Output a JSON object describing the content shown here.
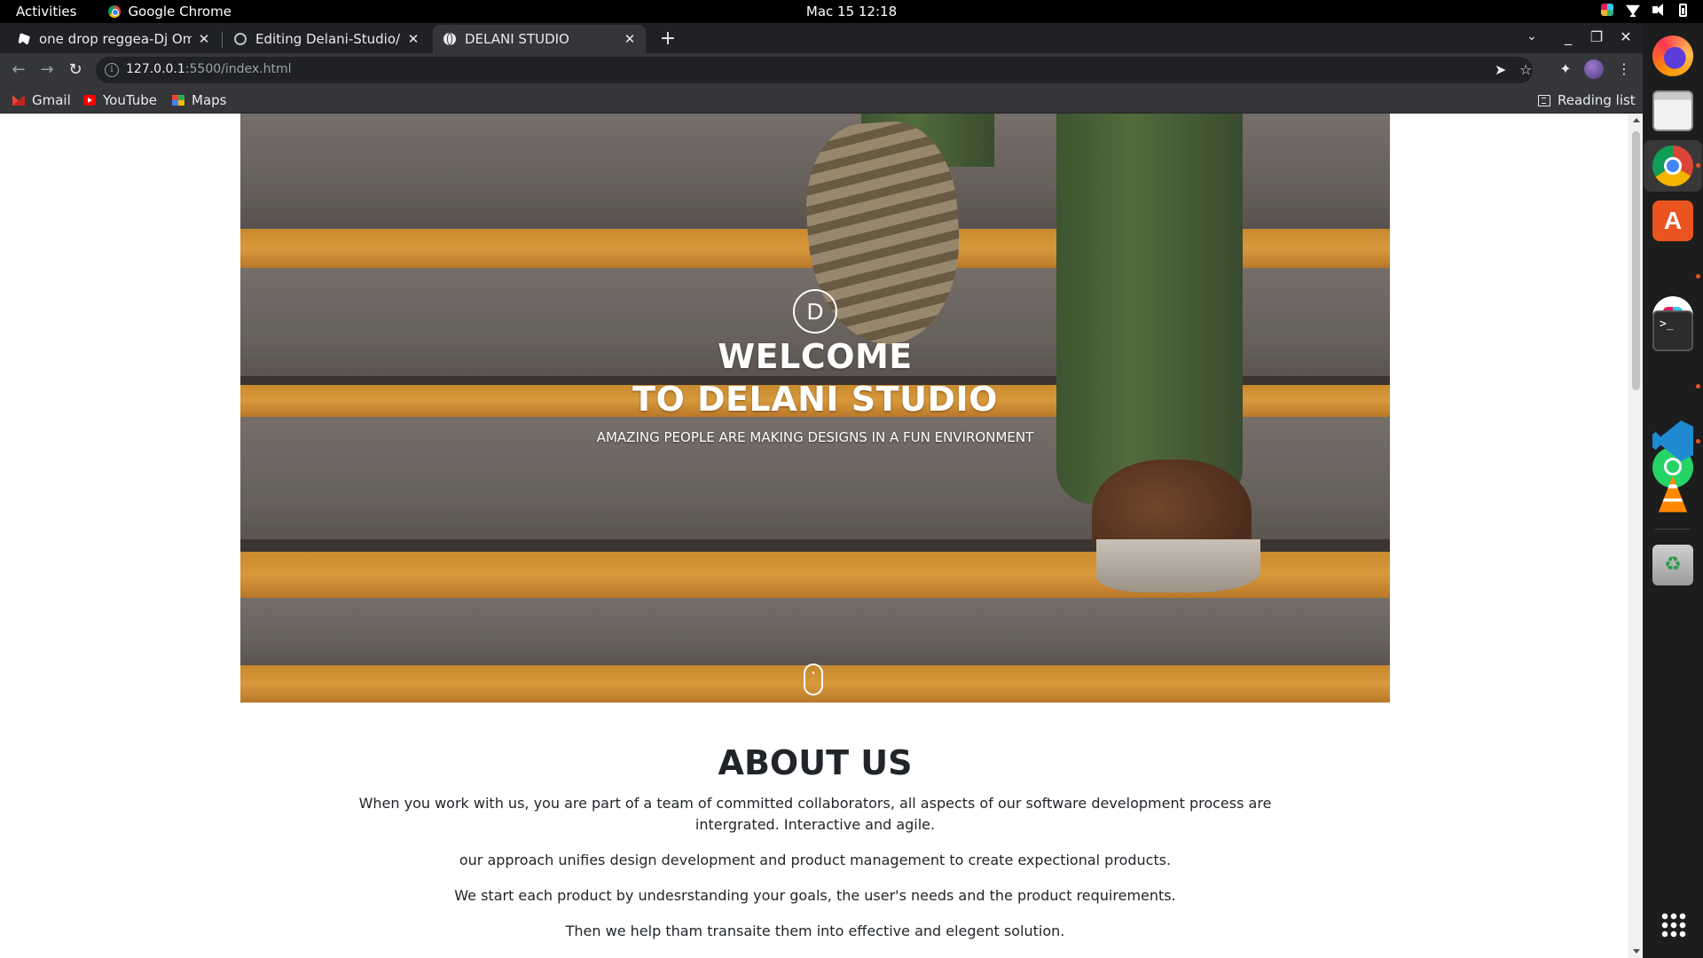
{
  "system_bar": {
    "activities": "Activities",
    "app_name": "Google Chrome",
    "datetime": "Mac 15  12:18"
  },
  "browser": {
    "tabs": [
      {
        "title": "one drop reggea-Dj Omsh",
        "icon": "music-icon",
        "active": false
      },
      {
        "title": "Editing Delani-Studio/RE/",
        "icon": "github-icon",
        "active": false
      },
      {
        "title": "DELANI STUDIO",
        "icon": "globe-icon",
        "active": true
      }
    ],
    "address": {
      "host": "127.0.0.1",
      "rest": ":5500/index.html"
    },
    "bookmarks": [
      {
        "label": "Gmail",
        "icon": "gmail-icon"
      },
      {
        "label": "YouTube",
        "icon": "youtube-icon"
      },
      {
        "label": "Maps",
        "icon": "maps-icon"
      }
    ],
    "reading_list": "Reading list"
  },
  "page": {
    "hero": {
      "logo_letter": "D",
      "title_line1": "WELCOME",
      "title_line2": "TO DELANI STUDIO",
      "subtitle": "AMAZING PEOPLE ARE MAKING DESIGNS IN A FUN ENVIRONMENT",
      "scroll_icon": "mouse-icon"
    },
    "about": {
      "heading": "ABOUT US",
      "paragraphs": [
        "When you work with us, you are part of a team of committed collaborators, all aspects of our software development process are intergrated. Interactive and agile.",
        "our approach unifies design development and product management to create expectional products.",
        "We start each product by undesrstanding your goals, the user's needs and the product requirements.",
        "Then we help tham transaite them into effective and elegent solution."
      ]
    }
  },
  "dock": {
    "apps": [
      "firefox-icon",
      "files-icon",
      "chrome-icon",
      "software-store-icon",
      "slack-icon",
      "terminal-icon",
      "whatsapp-icon",
      "vscode-icon",
      "vlc-icon",
      "trash-icon",
      "app-grid-icon"
    ],
    "colors": {
      "accent": "#e95420"
    }
  }
}
